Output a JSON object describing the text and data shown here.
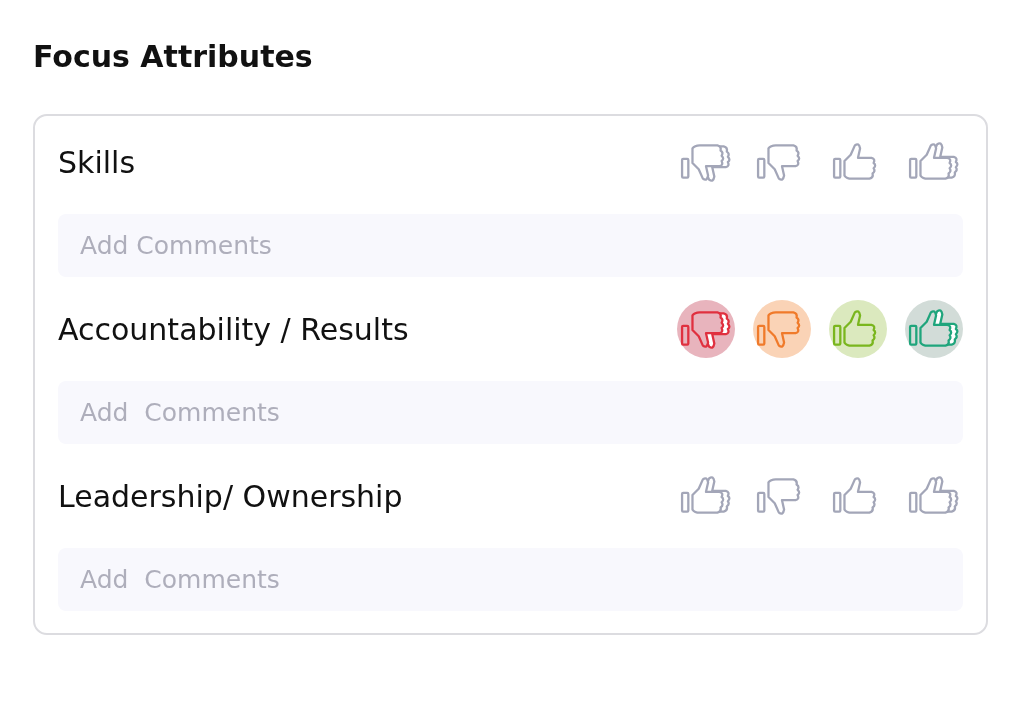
{
  "title": "Focus Attributes",
  "attributes": [
    {
      "label": "Skills",
      "highlighted": false,
      "ratings": [
        {
          "kind": "double-down"
        },
        {
          "kind": "down"
        },
        {
          "kind": "up"
        },
        {
          "kind": "double-up"
        }
      ],
      "comment": {
        "placeholder": "Add Comments"
      }
    },
    {
      "label": "Accountability / Results",
      "highlighted": true,
      "ratings": [
        {
          "kind": "double-down"
        },
        {
          "kind": "down"
        },
        {
          "kind": "up"
        },
        {
          "kind": "double-up"
        }
      ],
      "comment": {
        "placeholder": "Add  Comments"
      }
    },
    {
      "label": "Leadership/ Ownership",
      "highlighted": false,
      "ratings": [
        {
          "kind": "double-up"
        },
        {
          "kind": "down"
        },
        {
          "kind": "up"
        },
        {
          "kind": "double-up"
        }
      ],
      "comment": {
        "placeholder": "Add  Comments"
      }
    }
  ]
}
